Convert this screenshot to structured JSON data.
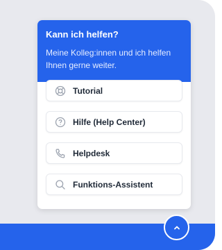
{
  "help_widget": {
    "title": "Kann ich helfen?",
    "subtitle": "Meine Kolleg:innen und ich helfen Ihnen gerne weiter.",
    "items": [
      {
        "label": "Tutorial",
        "icon": "lifebuoy-icon"
      },
      {
        "label": "Hilfe (Help Center)",
        "icon": "question-circle-icon"
      },
      {
        "label": "Helpdesk",
        "icon": "phone-icon"
      },
      {
        "label": "Funktions-Assistent",
        "icon": "search-icon"
      }
    ]
  },
  "scroll_top": {
    "icon": "chevron-up-icon"
  },
  "colors": {
    "accent": "#2563eb",
    "background": "#e8e9ee",
    "card": "#ffffff",
    "text": "#1f2937",
    "icon": "#9ca3af"
  }
}
